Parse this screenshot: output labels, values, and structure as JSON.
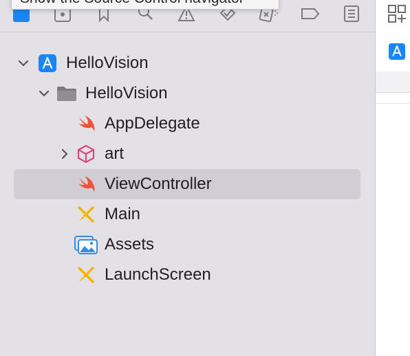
{
  "tooltip": {
    "text": "Show the Source Control navigator"
  },
  "toolbar": {
    "icons": [
      "project-navigator-icon",
      "source-control-icon",
      "symbol-icon",
      "find-icon",
      "issue-icon",
      "test-icon",
      "debug-icon",
      "breakpoint-icon",
      "report-icon"
    ]
  },
  "tree": {
    "items": [
      {
        "label": "HelloVision",
        "icon": "xcode-project-icon",
        "expanded": true
      },
      {
        "label": "HelloVision",
        "icon": "folder-icon",
        "expanded": true
      },
      {
        "label": "AppDelegate",
        "icon": "swift-file-icon"
      },
      {
        "label": "art",
        "icon": "package-icon",
        "expanded": false
      },
      {
        "label": "ViewController",
        "icon": "swift-file-icon",
        "selected": true
      },
      {
        "label": "Main",
        "icon": "storyboard-icon"
      },
      {
        "label": "Assets",
        "icon": "asset-catalog-icon"
      },
      {
        "label": "LaunchScreen",
        "icon": "storyboard-icon"
      }
    ]
  },
  "inspector": {
    "icons": [
      "library-icon",
      "xcode-app-icon"
    ]
  },
  "colors": {
    "accent": "#1a86f5",
    "swift": "#f05138",
    "selection": "#d0ced4",
    "storyboard": "#f5b400",
    "package": "#d6497a"
  }
}
